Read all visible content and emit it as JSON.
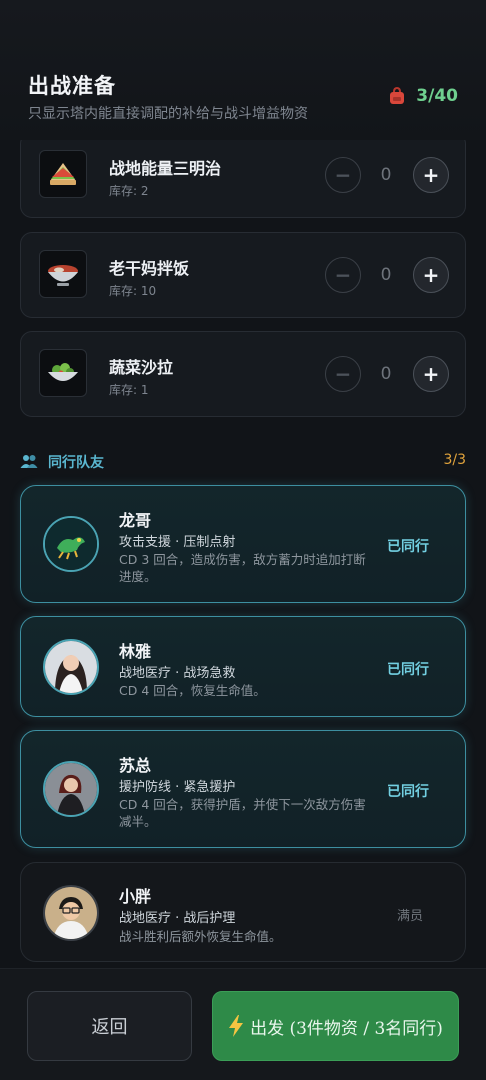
{
  "header": {
    "title": "出战准备",
    "subtitle": "只显示塔内能直接调配的补给与战斗增益物资",
    "capacity": "3/40",
    "capacity_icon": "backpack-icon"
  },
  "items": [
    {
      "name": "战地能量三明治",
      "stock": "库存: 2",
      "quantity": "0",
      "icon": "sandwich-icon"
    },
    {
      "name": "老干妈拌饭",
      "stock": "库存: 10",
      "quantity": "0",
      "icon": "rice-bowl-icon"
    },
    {
      "name": "蔬菜沙拉",
      "stock": "库存: 1",
      "quantity": "0",
      "icon": "salad-icon"
    }
  ],
  "stepper": {
    "minus": "−",
    "plus": "+"
  },
  "team": {
    "title": "同行队友",
    "count": "3/3",
    "members": [
      {
        "name": "龙哥",
        "role": "攻击支援 · 压制点射",
        "desc": "CD 3 回合，造成伤害，敌方蓄力时追加打断进度。",
        "status": "已同行"
      },
      {
        "name": "林雅",
        "role": "战地医疗 · 战场急救",
        "desc": "CD 4 回合，恢复生命值。",
        "status": "已同行"
      },
      {
        "name": "苏总",
        "role": "援护防线 · 紧急援护",
        "desc": "CD 4 回合，获得护盾，并使下一次敌方伤害减半。",
        "status": "已同行"
      },
      {
        "name": "小胖",
        "role": "战地医疗 · 战后护理",
        "desc": "战斗胜利后额外恢复生命值。",
        "status": "满员"
      }
    ]
  },
  "footer": {
    "back_label": "返回",
    "depart_label": "出发 (3件物资 / 3名同行)"
  },
  "colors": {
    "accent_teal": "#5ab6cf",
    "go_green": "#2e8a48",
    "capacity_green": "#6fd08f",
    "count_orange": "#e0a33c"
  }
}
